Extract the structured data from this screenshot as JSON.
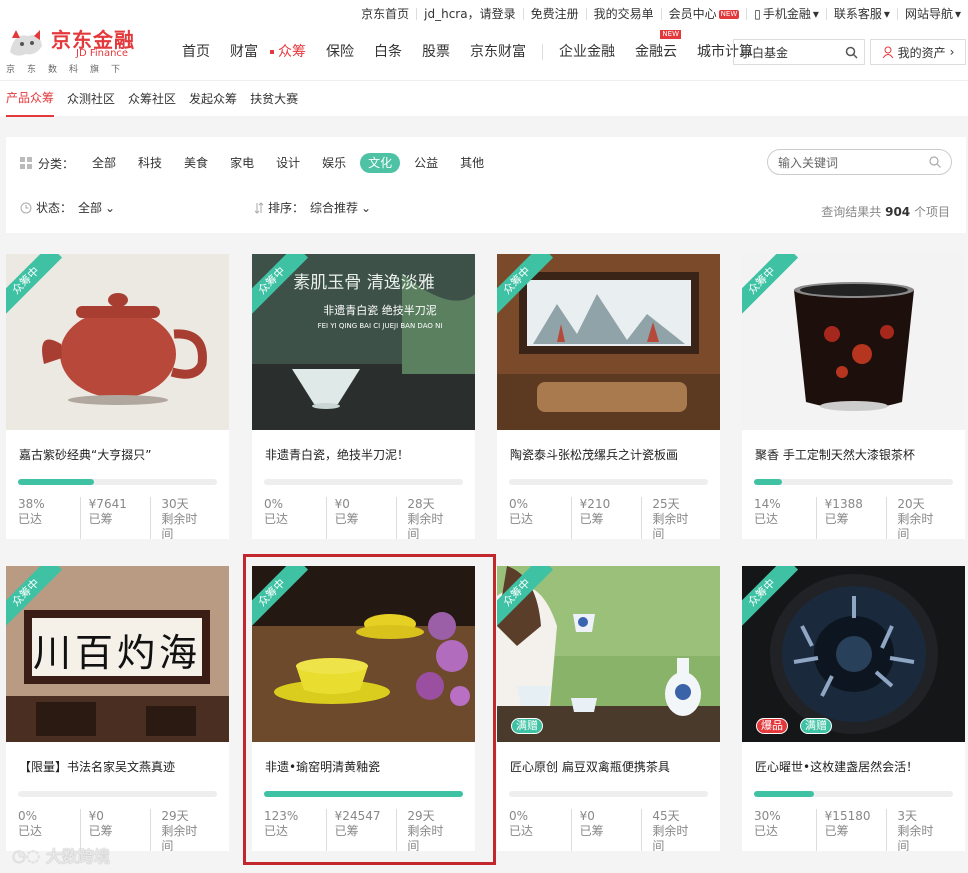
{
  "topbar": {
    "items": [
      "京东首页",
      "jd_hcra，请登录",
      "免费注册",
      "我的交易单",
      "会员中心",
      "手机金融",
      "联系客服",
      "网站导航"
    ],
    "new_badge": "NEW"
  },
  "logo": {
    "cn": "京东金融",
    "en": "JD Finance",
    "tagline": "京东数科旗下"
  },
  "nav": {
    "items": [
      "首页",
      "财富",
      "众筹",
      "保险",
      "白条",
      "股票",
      "京东财富",
      "企业金融",
      "金融云",
      "城市计算"
    ],
    "active": "众筹",
    "new_badge": "NEW"
  },
  "search_top": {
    "value": "小白基金"
  },
  "assets_button": "我的资产",
  "subnav": {
    "items": [
      "产品众筹",
      "众测社区",
      "众筹社区",
      "发起众筹",
      "扶贫大赛"
    ]
  },
  "filter": {
    "category_label": "分类：",
    "categories": [
      "全部",
      "科技",
      "美食",
      "家电",
      "设计",
      "娱乐",
      "文化",
      "公益",
      "其他"
    ],
    "active_category": "文化",
    "keyword_placeholder": "输入关键词",
    "status_label": "状态：",
    "status_value": "全部",
    "sort_label": "排序：",
    "sort_value": "综合推荐",
    "result_prefix": "查询结果共",
    "result_count": "904",
    "result_suffix": "个项目"
  },
  "labels": {
    "reached": "已达",
    "raised": "已筹",
    "remaining": "剩余时间",
    "ribbon": "众筹中"
  },
  "cards": [
    {
      "title": "嘉古紫砂经典“大亨掇只”",
      "percent": "38%",
      "progress": 0.38,
      "amount": "¥7641",
      "days": "30天"
    },
    {
      "title": "非遗青白瓷，绝技半刀泥！",
      "percent": "0%",
      "progress": 0,
      "amount": "¥0",
      "days": "28天",
      "overlay_title": "素肌玉骨 清逸淡雅",
      "overlay_sub": "非遗青白瓷 绝技半刀泥",
      "overlay_pinyin": "FEI YI QING BAI CI JUEJI BAN DAO NI"
    },
    {
      "title": "陶瓷泰斗张松茂缧兵之计瓷板画",
      "percent": "0%",
      "progress": 0,
      "amount": "¥210",
      "days": "25天"
    },
    {
      "title": "聚香 手工定制天然大漆银茶杯",
      "percent": "14%",
      "progress": 0.14,
      "amount": "¥1388",
      "days": "20天"
    },
    {
      "title": "【限量】书法名家吴文燕真迹",
      "percent": "0%",
      "progress": 0,
      "amount": "¥0",
      "days": "29天",
      "calligraphy": "川百灼海"
    },
    {
      "title": "非遗•瑜窑明清黄釉瓷",
      "percent": "123%",
      "progress": 1,
      "amount": "¥24547",
      "days": "29天"
    },
    {
      "title": "匠心原创 扁豆双禽瓶便携茶具",
      "percent": "0%",
      "progress": 0,
      "amount": "¥0",
      "days": "45天",
      "tags": [
        "满赠"
      ]
    },
    {
      "title": "匠心曜世•这枚建盏居然会活！",
      "percent": "30%",
      "progress": 0.3,
      "amount": "¥15180",
      "days": "3天",
      "tags": [
        "爆品",
        "满赠"
      ]
    }
  ],
  "watermark": "大数跨境",
  "colors": {
    "accent": "#e4393c",
    "teal": "#3ec2a3",
    "highlight": "#c1272d"
  }
}
